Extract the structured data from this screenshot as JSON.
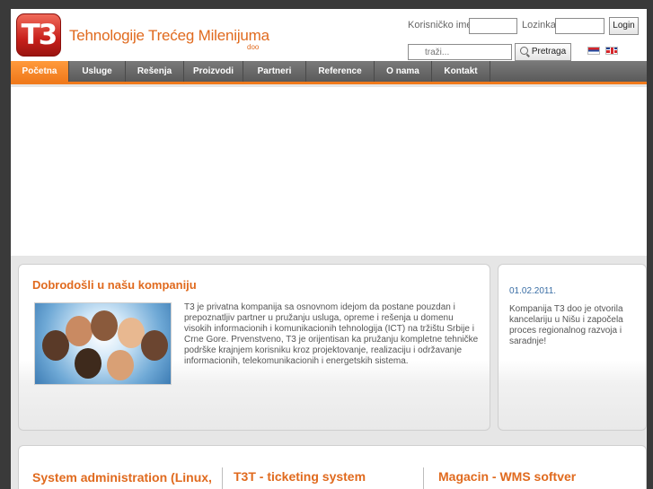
{
  "header": {
    "logo_mark": "T3",
    "company_name": "Tehnologije Trećeg Milenijuma",
    "company_suffix": "doo",
    "username_label": "Korisničko ime",
    "password_label": "Lozinka",
    "login_button": "Login",
    "search_placeholder": "traži...",
    "search_button": "Pretraga",
    "languages": [
      "Serbian flag",
      "English flag"
    ]
  },
  "nav": {
    "items": [
      "Početna",
      "Usluge",
      "Rešenja",
      "Proizvodi",
      "Partneri",
      "Reference",
      "O nama",
      "Kontakt"
    ],
    "active": "Početna"
  },
  "welcome": {
    "title": "Dobrodošli u našu kompaniju",
    "text": "T3 je privatna kompanija sa osnovnom idejom da postane pouzdan i prepoznatljiv partner u pružanju usluga, opreme i rešenja u domenu visokih informacionih i komunikacionih tehnologija (ICT) na tržištu Srbije i Crne Gore. Prvenstveno, T3 je orijentisan ka pružanju kompletne tehničke podrške krajnjem korisniku kroz projektovanje, realizaciju i održavanje informacionih, telekomunikacionih i energetskih sistema."
  },
  "news": {
    "date": "01.02.2011.",
    "text": "Kompanija T3 doo je otvorila kancelariju u Nišu i započela proces regionalnog razvoja i saradnje!"
  },
  "features": [
    {
      "title": "System administration (Linux, Windows)"
    },
    {
      "title": "T3T - ticketing system"
    },
    {
      "title": "Magacin - WMS softver"
    }
  ],
  "colors": {
    "accent": "#f07a1c",
    "title": "#e06a1e",
    "nav": "#666666",
    "date": "#3a6ea5"
  }
}
